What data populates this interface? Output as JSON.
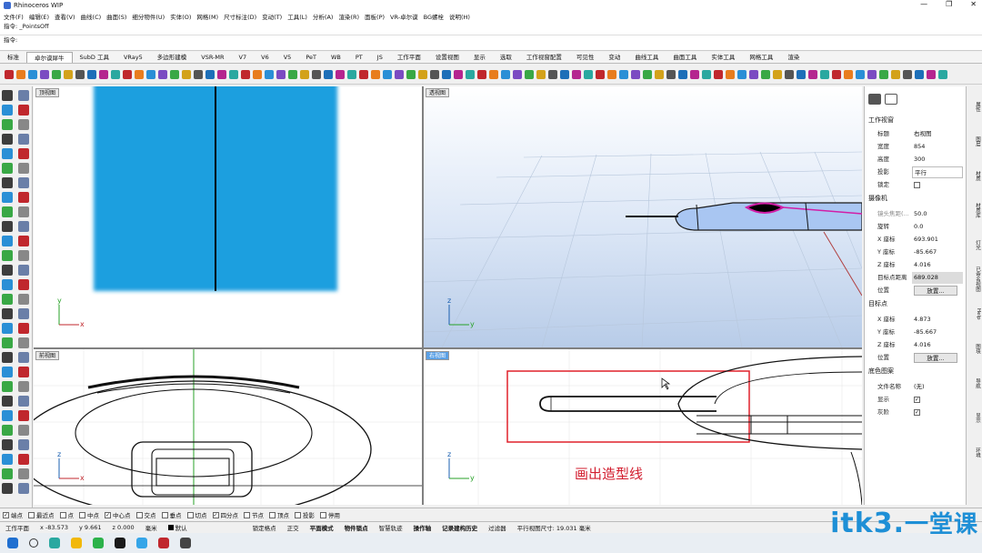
{
  "window": {
    "title": "Rhinoceros WIP",
    "controls": [
      "—",
      "❐",
      "✕"
    ]
  },
  "menu": [
    "文件(F)",
    "编辑(E)",
    "查看(V)",
    "曲线(C)",
    "曲面(S)",
    "细分物件(U)",
    "实体(O)",
    "网格(M)",
    "尺寸标注(D)",
    "变动(T)",
    "工具(L)",
    "分析(A)",
    "渲染(R)",
    "面板(P)",
    "VR-卓尔谟",
    "BG螺栓",
    "说明(H)"
  ],
  "command": {
    "history": "指令: _PointsOff",
    "prompt": "指令:"
  },
  "tabs": [
    "标准",
    "卓尔谟犀牛",
    "SubD 工具",
    "VRay5",
    "多边形建模",
    "VSR-MR",
    "V7",
    "V6",
    "V5",
    "PeT",
    "WB",
    "PT",
    "JS",
    "工作平面",
    "设置视图",
    "显示",
    "选取",
    "工作视窗配置",
    "可见性",
    "变动",
    "曲线工具",
    "曲面工具",
    "实体工具",
    "网格工具",
    "渲染"
  ],
  "active_tab_index": 1,
  "viewports": {
    "top": {
      "label": "顶视图"
    },
    "perspective": {
      "label": "透视图"
    },
    "front": {
      "label": "前视图"
    },
    "right": {
      "label": "右视图"
    }
  },
  "annotation": "画出造型线",
  "panel": {
    "section_viewport": "工作视窗",
    "title_k": "标题",
    "title_v": "右视图",
    "width_k": "宽度",
    "width_v": "854",
    "height_k": "高度",
    "height_v": "300",
    "proj_k": "投影",
    "proj_v": "平行",
    "lock_k": "锁定",
    "section_camera": "摄像机",
    "focal_k": "镜头焦距(...",
    "focal_v": "50.0",
    "rot_k": "旋转",
    "rot_v": "0.0",
    "cx_k": "X 座标",
    "cx_v": "693.901",
    "cy_k": "Y 座标",
    "cy_v": "-85.667",
    "cz_k": "Z 座标",
    "cz_v": "4.016",
    "dist_k": "目标点距离",
    "dist_v": "689.028",
    "pos_k": "位置",
    "place_btn": "放置...",
    "section_target": "目标点",
    "tx_k": "X 座标",
    "tx_v": "4.873",
    "ty_k": "Y 座标",
    "ty_v": "-85.667",
    "tz_k": "Z 座标",
    "tz_v": "4.016",
    "tpos_k": "位置",
    "tplace_btn": "放置...",
    "section_bg": "底色图案",
    "file_k": "文件名称",
    "file_v": "(无)",
    "show_k": "显示",
    "gray_k": "灰阶"
  },
  "side_tabs": [
    "属性",
    "图层",
    "材质",
    "材质库",
    "灯光",
    "已命名视图",
    "Help",
    "图块",
    "导航",
    "显示",
    "环境"
  ],
  "osnap": [
    {
      "label": "端点",
      "on": true
    },
    {
      "label": "最近点",
      "on": false
    },
    {
      "label": "点",
      "on": false
    },
    {
      "label": "中点",
      "on": false
    },
    {
      "label": "中心点",
      "on": true
    },
    {
      "label": "交点",
      "on": false
    },
    {
      "label": "垂点",
      "on": false
    },
    {
      "label": "切点",
      "on": false
    },
    {
      "label": "四分点",
      "on": true
    },
    {
      "label": "节点",
      "on": false
    },
    {
      "label": "顶点",
      "on": false
    },
    {
      "label": "投影",
      "on": false
    },
    {
      "label": "停用",
      "on": false
    }
  ],
  "status": {
    "plane": "工作平面",
    "x": "x -83.573",
    "y": "y 9.661",
    "z": "z 0.000",
    "unit": "毫米",
    "layer": "默认",
    "items": [
      "锁定格点",
      "正交",
      "平面模式",
      "物件锁点",
      "智慧轨迹",
      "操作轴",
      "记录建构历史",
      "过滤器",
      "平行视图尺寸: 19.031 毫米"
    ]
  },
  "watermark": {
    "latin": "itk3",
    "dot": ".",
    "cn": "一堂课"
  }
}
